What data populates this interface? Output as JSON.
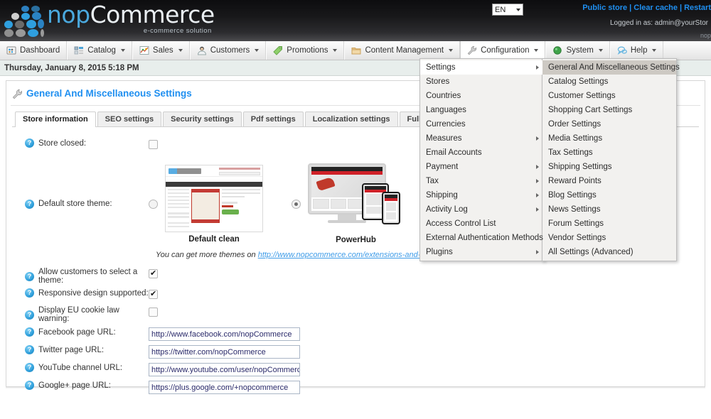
{
  "header": {
    "brand_np": "nop",
    "brand_commerce": "Commerce",
    "tagline": "e-commerce solution",
    "language": "EN",
    "links": {
      "public_store": "Public store",
      "clear_cache": "Clear cache",
      "restart": "Restart",
      "sep": "|"
    },
    "logged_in": "Logged in as: admin@yourStor",
    "version": "nop"
  },
  "menubar": [
    {
      "label": "Dashboard",
      "icon": "dashboard-icon",
      "caret": false
    },
    {
      "label": "Catalog",
      "icon": "catalog-icon",
      "caret": true
    },
    {
      "label": "Sales",
      "icon": "sales-icon",
      "caret": true
    },
    {
      "label": "Customers",
      "icon": "customers-icon",
      "caret": true
    },
    {
      "label": "Promotions",
      "icon": "promotions-icon",
      "caret": true
    },
    {
      "label": "Content Management",
      "icon": "content-management-icon",
      "caret": true
    },
    {
      "label": "Configuration",
      "icon": "configuration-wrench-icon",
      "caret": true
    },
    {
      "label": "System",
      "icon": "system-icon",
      "caret": true
    },
    {
      "label": "Help",
      "icon": "help-icon",
      "caret": true
    }
  ],
  "datebar": {
    "text": "Thursday, January 8, 2015 5:18 PM"
  },
  "page": {
    "title": "General And Miscellaneous Settings",
    "title_icon": "wrench-icon",
    "tabs": [
      {
        "label": "Store information",
        "active": true
      },
      {
        "label": "SEO settings",
        "active": false
      },
      {
        "label": "Security settings",
        "active": false
      },
      {
        "label": "Pdf settings",
        "active": false
      },
      {
        "label": "Localization settings",
        "active": false
      },
      {
        "label": "Full-Text settings",
        "active": false
      }
    ]
  },
  "form": {
    "store_closed": {
      "label": "Store closed:",
      "checked": false
    },
    "default_theme": {
      "label": "Default store theme:",
      "options": [
        {
          "name": "Default clean",
          "selected": false
        },
        {
          "name": "PowerHub",
          "selected": true
        }
      ]
    },
    "themes_hint_prefix": "You can get more themes on ",
    "themes_hint_link": "http://www.nopcommerce.com/extensions-and-themes.aspx",
    "allow_select_theme": {
      "label": "Allow customers to select a theme:",
      "checked": true
    },
    "responsive": {
      "label": "Responsive design supported:",
      "checked": true
    },
    "eu_cookie": {
      "label": "Display EU cookie law warning:",
      "checked": false
    },
    "facebook": {
      "label": "Facebook page URL:",
      "value": "http://www.facebook.com/nopCommerce"
    },
    "twitter": {
      "label": "Twitter page URL:",
      "value": "https://twitter.com/nopCommerce"
    },
    "youtube": {
      "label": "YouTube channel URL:",
      "value": "http://www.youtube.com/user/nopCommerce"
    },
    "googleplus": {
      "label": "Google+ page URL:",
      "value": "https://plus.google.com/+nopcommerce"
    }
  },
  "dropdown": {
    "column1": [
      {
        "label": "Settings",
        "submenu": true,
        "state": "hl"
      },
      {
        "label": "Stores",
        "submenu": false,
        "state": ""
      },
      {
        "label": "Countries",
        "submenu": false,
        "state": ""
      },
      {
        "label": "Languages",
        "submenu": false,
        "state": ""
      },
      {
        "label": "Currencies",
        "submenu": false,
        "state": ""
      },
      {
        "label": "Measures",
        "submenu": true,
        "state": ""
      },
      {
        "label": "Email Accounts",
        "submenu": false,
        "state": ""
      },
      {
        "label": "Payment",
        "submenu": true,
        "state": ""
      },
      {
        "label": "Tax",
        "submenu": true,
        "state": ""
      },
      {
        "label": "Shipping",
        "submenu": true,
        "state": ""
      },
      {
        "label": "Activity Log",
        "submenu": true,
        "state": ""
      },
      {
        "label": "Access Control List",
        "submenu": false,
        "state": ""
      },
      {
        "label": "External Authentication Methods",
        "submenu": false,
        "state": ""
      },
      {
        "label": "Plugins",
        "submenu": true,
        "state": ""
      }
    ],
    "column2": [
      {
        "label": "General And Miscellaneous Settings",
        "submenu": false,
        "state": "hl2"
      },
      {
        "label": "Catalog Settings",
        "submenu": false,
        "state": ""
      },
      {
        "label": "Customer Settings",
        "submenu": false,
        "state": ""
      },
      {
        "label": "Shopping Cart Settings",
        "submenu": false,
        "state": ""
      },
      {
        "label": "Order Settings",
        "submenu": false,
        "state": ""
      },
      {
        "label": "Media Settings",
        "submenu": false,
        "state": ""
      },
      {
        "label": "Tax Settings",
        "submenu": false,
        "state": ""
      },
      {
        "label": "Shipping Settings",
        "submenu": false,
        "state": ""
      },
      {
        "label": "Reward Points",
        "submenu": false,
        "state": ""
      },
      {
        "label": "Blog Settings",
        "submenu": false,
        "state": ""
      },
      {
        "label": "News Settings",
        "submenu": false,
        "state": ""
      },
      {
        "label": "Forum Settings",
        "submenu": false,
        "state": ""
      },
      {
        "label": "Vendor Settings",
        "submenu": false,
        "state": ""
      },
      {
        "label": "All Settings (Advanced)",
        "submenu": false,
        "state": ""
      }
    ]
  },
  "colors": {
    "brand_blue": "#4aa8dd",
    "link_blue": "#1f8ff0",
    "header_dark": "#101012",
    "date_bar": "#e8eeec",
    "menu_highlight": "#cdc9c3"
  }
}
